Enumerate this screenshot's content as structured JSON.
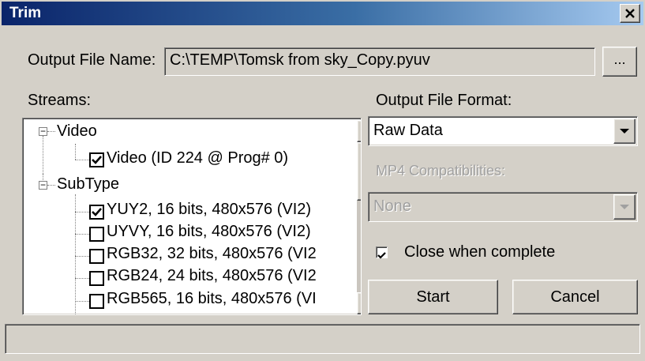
{
  "dialog": {
    "title": "Trim",
    "close_glyph": "X"
  },
  "output_file": {
    "label": "Output File Name:",
    "value": "C:\\TEMP\\Tomsk from sky_Copy.pyuv",
    "browse_label": "..."
  },
  "streams": {
    "label": "Streams:",
    "tree": [
      {
        "type": "group",
        "label": "Video",
        "expander": "−"
      },
      {
        "type": "item",
        "label": "Video (ID 224 @ Prog# 0)",
        "checked": true
      },
      {
        "type": "group",
        "label": "SubType",
        "expander": "−"
      },
      {
        "type": "item",
        "label": "YUY2, 16 bits, 480x576 (VI2)",
        "checked": true
      },
      {
        "type": "item",
        "label": "UYVY, 16 bits, 480x576 (VI2)",
        "checked": false
      },
      {
        "type": "item",
        "label": "RGB32, 32 bits, 480x576 (VI2",
        "checked": false
      },
      {
        "type": "item",
        "label": "RGB24, 24 bits, 480x576 (VI2",
        "checked": false
      },
      {
        "type": "item",
        "label": "RGB565, 16 bits, 480x576 (VI",
        "checked": false
      }
    ]
  },
  "format": {
    "label": "Output File Format:",
    "selected": "Raw Data"
  },
  "mp4": {
    "label": "MP4 Compatibilities:",
    "selected": "None",
    "enabled": false
  },
  "close_when_complete": {
    "label": "Close when complete",
    "checked": true
  },
  "buttons": {
    "start": "Start",
    "cancel": "Cancel"
  },
  "status_bar": {
    "text": ""
  },
  "icons": {
    "close": "close-icon",
    "dropdown": "chevron-down-icon",
    "scroll_up": "arrow-up-icon",
    "scroll_down": "arrow-down-icon",
    "check": "checkmark-icon"
  }
}
